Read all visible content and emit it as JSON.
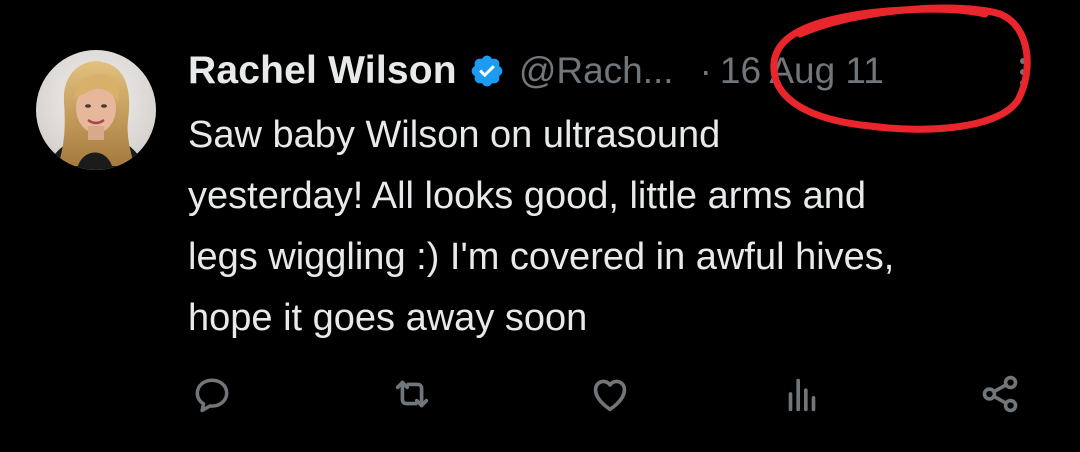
{
  "user": {
    "display_name": "Rachel Wilson",
    "handle": "@Rach...",
    "verified": true,
    "avatar_icon": "profile-photo"
  },
  "tweet": {
    "separator": "·",
    "date": "16 Aug 11",
    "lines": [
      "Saw baby Wilson on ultrasound",
      "yesterday! All looks good, little arms and",
      "legs wiggling :) I'm covered in awful hives,",
      "hope it goes away soon"
    ]
  },
  "actions": [
    {
      "icon": "reply-icon"
    },
    {
      "icon": "retweet-icon"
    },
    {
      "icon": "like-icon"
    },
    {
      "icon": "views-icon"
    },
    {
      "icon": "share-icon"
    }
  ],
  "colors": {
    "background": "#000000",
    "text": "#e7e9ea",
    "muted": "#71767b",
    "verified": "#1d9bf0",
    "annotation": "#e8262b"
  }
}
